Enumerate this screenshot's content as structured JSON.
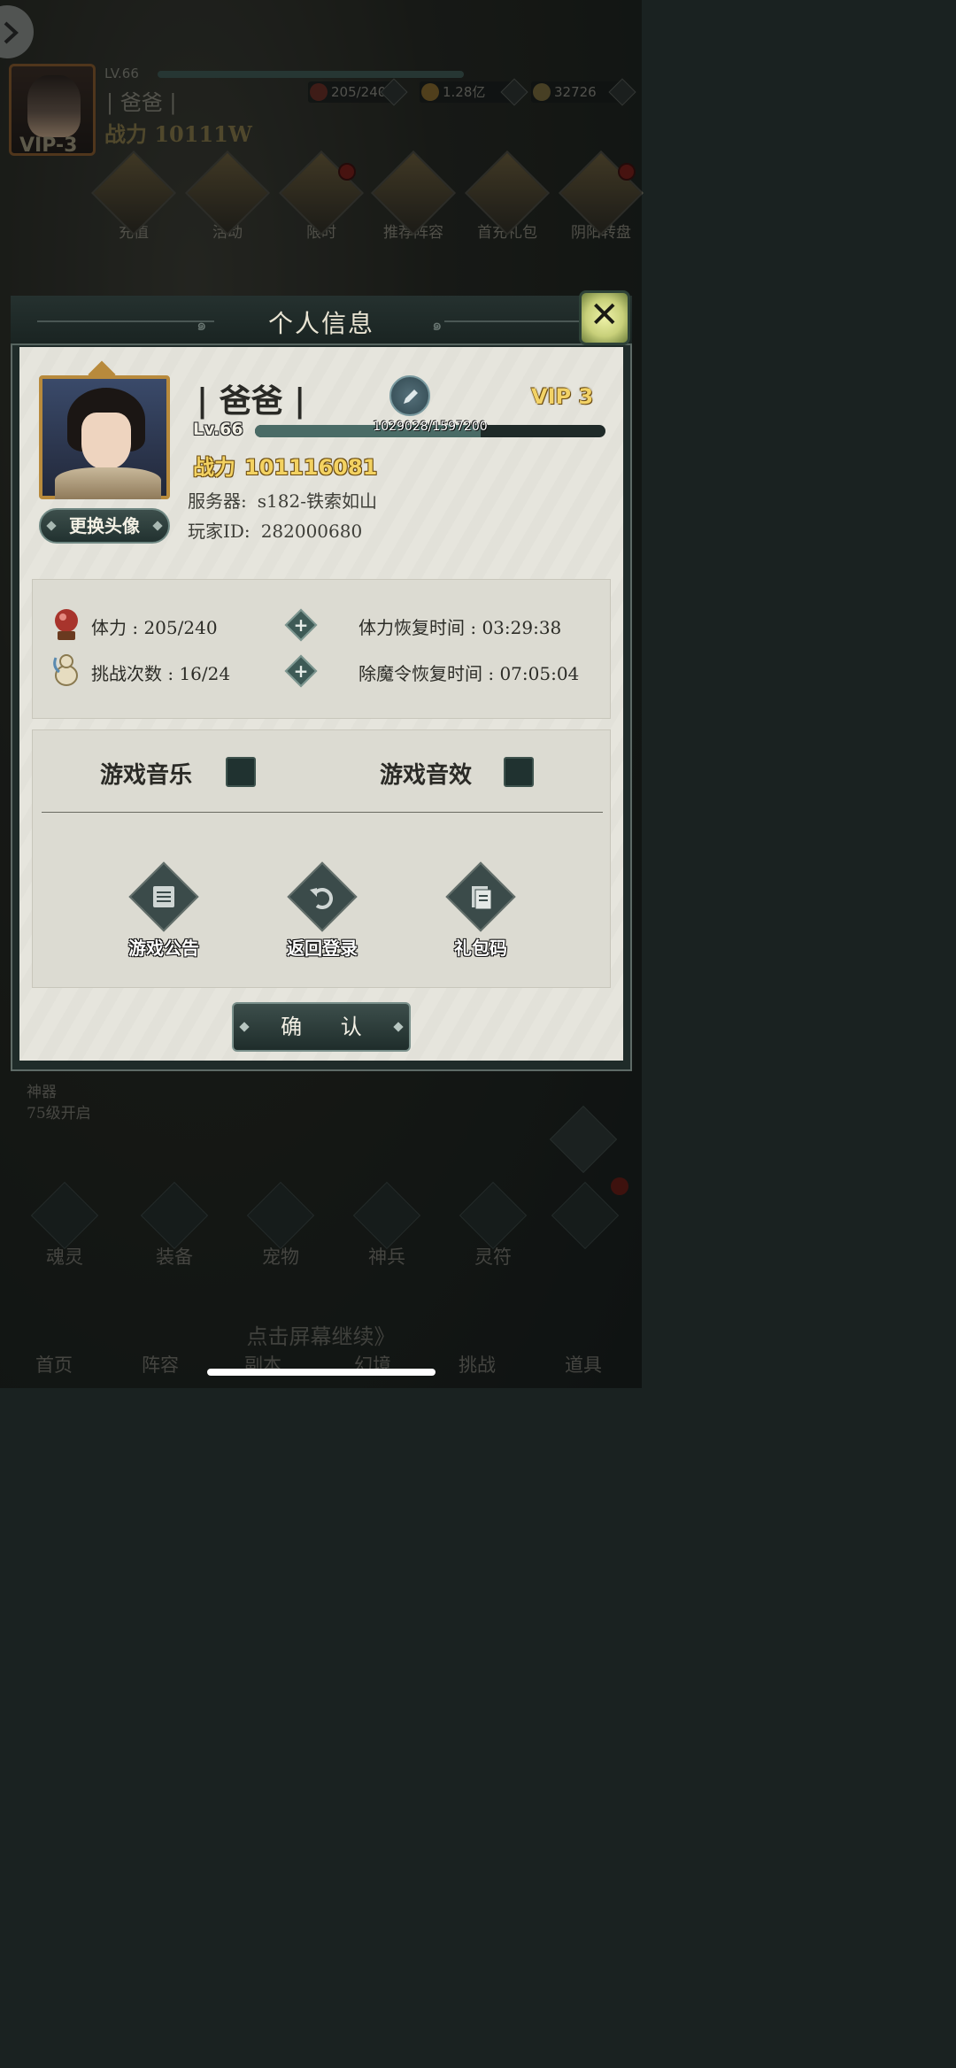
{
  "hud": {
    "level": "LV.66",
    "name": "| 爸爸 |",
    "power": "战力 10111W",
    "vip": "VIP-3",
    "stamina": "205/240",
    "gold": "1.28亿",
    "jade": "32726"
  },
  "top_icons": [
    {
      "label": "充值",
      "icon": "recharge-icon"
    },
    {
      "label": "活动",
      "icon": "event-icon"
    },
    {
      "label": "限时",
      "icon": "limited-icon"
    },
    {
      "label": "推荐阵容",
      "icon": "lineup-icon"
    },
    {
      "label": "首充礼包",
      "icon": "first-recharge-icon"
    },
    {
      "label": "阴阳转盘",
      "icon": "wheel-icon"
    }
  ],
  "dialog": {
    "title": "个人信息",
    "player_name": "| 爸爸 |",
    "vip": "VIP 3",
    "level": "Lv.66",
    "exp_text": "1029028/1597200",
    "exp_fraction": 0.644,
    "power_label": "战力",
    "power_value": "101116081",
    "server_label": "服务器:",
    "server_value": "s182-铁索如山",
    "player_id_label": "玩家ID:",
    "player_id_value": "282000680",
    "change_avatar": "更换头像",
    "stats": {
      "stamina": "体力 : 205/240",
      "challenges": "挑战次数 : 16/24",
      "stamina_recover": "体力恢复时间 : 03:29:38",
      "token_recover": "除魔令恢复时间 : 07:05:04"
    },
    "settings": {
      "music": "游戏音乐",
      "sfx": "游戏音效"
    },
    "actions": {
      "announcement": "游戏公告",
      "return_login": "返回登录",
      "gift_code": "礼包码"
    },
    "confirm": "确 认"
  },
  "background": {
    "artifact_line1": "神器",
    "artifact_line2": "75级开启",
    "nav_row1": [
      "魂灵",
      "装备",
      "宠物",
      "神兵",
      "灵符"
    ],
    "nav_row2": [
      "首页",
      "阵容",
      "副本",
      "幻境",
      "挑战",
      "道具"
    ],
    "tap_continue": "点击屏幕继续》"
  },
  "colors": {
    "gold_text": "#f3d261",
    "panel_bg": "#e6e5dd",
    "frame_dark": "#1f2b29",
    "toggle": "#203230"
  }
}
